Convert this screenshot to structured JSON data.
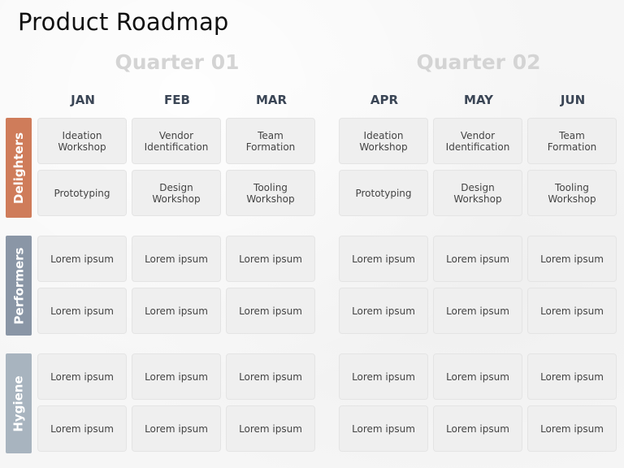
{
  "title": "Product Roadmap",
  "quarters": [
    {
      "label": "Quarter 01",
      "months": [
        "JAN",
        "FEB",
        "MAR"
      ]
    },
    {
      "label": "Quarter 02",
      "months": [
        "APR",
        "MAY",
        "JUN"
      ]
    }
  ],
  "colors": {
    "delighters": "#cf7c5a",
    "performers": "#8a96a6",
    "hygiene": "#a8b4bf",
    "month_text": "#3b4656",
    "quarter_text": "#d4d4d4"
  },
  "groups": [
    {
      "label": "Delighters",
      "rows": [
        [
          "Ideation\nWorkshop",
          "Vendor\nIdentification",
          "Team\nFormation",
          "Ideation\nWorkshop",
          "Vendor\nIdentification",
          "Team\nFormation"
        ],
        [
          "Prototyping",
          "Design\nWorkshop",
          "Tooling\nWorkshop",
          "Prototyping",
          "Design\nWorkshop",
          "Tooling\nWorkshop"
        ]
      ]
    },
    {
      "label": "Performers",
      "rows": [
        [
          "Lorem ipsum",
          "Lorem ipsum",
          "Lorem ipsum",
          "Lorem ipsum",
          "Lorem ipsum",
          "Lorem ipsum"
        ],
        [
          "Lorem ipsum",
          "Lorem ipsum",
          "Lorem ipsum",
          "Lorem ipsum",
          "Lorem ipsum",
          "Lorem ipsum"
        ]
      ]
    },
    {
      "label": "Hygiene",
      "rows": [
        [
          "Lorem ipsum",
          "Lorem ipsum",
          "Lorem ipsum",
          "Lorem ipsum",
          "Lorem ipsum",
          "Lorem ipsum"
        ],
        [
          "Lorem ipsum",
          "Lorem ipsum",
          "Lorem ipsum",
          "Lorem ipsum",
          "Lorem ipsum",
          "Lorem ipsum"
        ]
      ]
    }
  ]
}
